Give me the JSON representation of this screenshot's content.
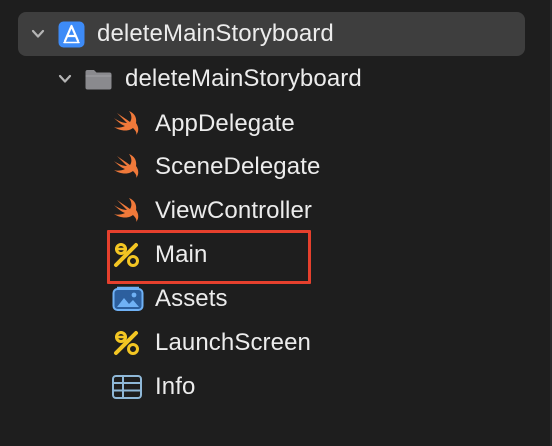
{
  "navigator": {
    "project": {
      "label": "deleteMainStoryboard",
      "icon": "xcode-project-icon",
      "expanded": true
    },
    "group": {
      "label": "deleteMainStoryboard",
      "icon": "folder-icon",
      "expanded": true
    },
    "files": [
      {
        "label": "AppDelegate",
        "icon": "swift-icon"
      },
      {
        "label": "SceneDelegate",
        "icon": "swift-icon"
      },
      {
        "label": "ViewController",
        "icon": "swift-icon"
      },
      {
        "label": "Main",
        "icon": "storyboard-icon"
      },
      {
        "label": "Assets",
        "icon": "asset-catalog-icon"
      },
      {
        "label": "LaunchScreen",
        "icon": "storyboard-icon"
      },
      {
        "label": "Info",
        "icon": "plist-icon"
      }
    ]
  },
  "colors": {
    "background": "#1e1e1e",
    "selected_row": "#3e3e3e",
    "text": "#ececec",
    "swift_orange": "#f0793a",
    "storyboard_yellow": "#f3c623",
    "annotation_red": "#e5402d",
    "folder_gray": "#8a8a8e",
    "project_blue": "#3d8bf7"
  }
}
